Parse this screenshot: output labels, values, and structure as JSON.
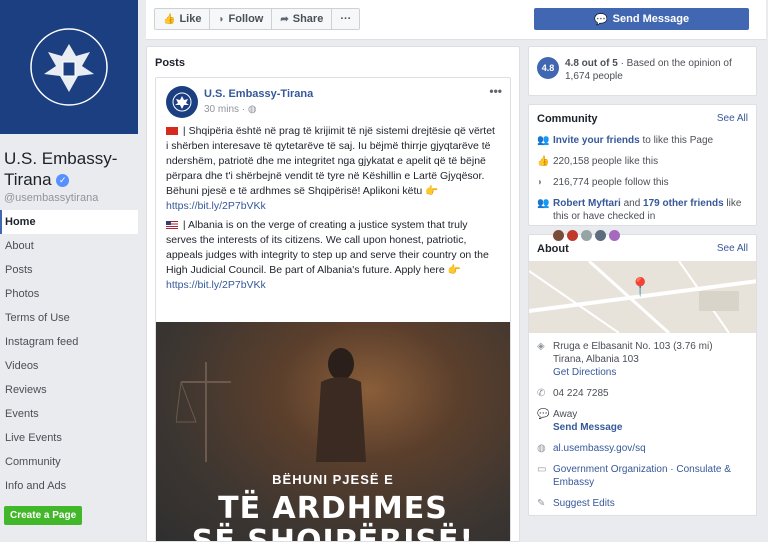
{
  "page": {
    "name": "U.S. Embassy-Tirana",
    "handle": "@usembassytirana"
  },
  "nav": [
    {
      "label": "Home"
    },
    {
      "label": "About"
    },
    {
      "label": "Posts"
    },
    {
      "label": "Photos"
    },
    {
      "label": "Terms of Use"
    },
    {
      "label": "Instagram feed"
    },
    {
      "label": "Videos"
    },
    {
      "label": "Reviews"
    },
    {
      "label": "Events"
    },
    {
      "label": "Live Events"
    },
    {
      "label": "Community"
    },
    {
      "label": "Info and Ads"
    }
  ],
  "create_page": "Create a Page",
  "actions": {
    "like": "Like",
    "follow": "Follow",
    "share": "Share",
    "more": "···",
    "send_message": "Send Message"
  },
  "posts": {
    "header": "Posts",
    "post": {
      "author": "U.S. Embassy-Tirana",
      "time": "30 mins",
      "text_sq": "| Shqipëria është në prag të krijimit të një sistemi drejtësie që vërtet i shërben interesave të qytetarëve të saj. Iu bëjmë thirrje gjyqtarëve të ndershëm, patriotë dhe me integritet nga gjykatat e apelit që të bëjnë përpara dhe t'i shërbejnë vendit të tyre në Këshillin e Lartë Gjyqësor. Bëhuni pjesë e të ardhmes së Shqipërisë! Aplikoni këtu",
      "link_sq": "https://bit.ly/2P7bVKk",
      "text_en": "| Albania is on the verge of creating a justice system that truly serves the interests of its citizens. We call upon honest, patriotic, appeals judges with integrity to step up and serve their country on the High Judicial Council. Be part of Albania's future. Apply here",
      "link_en": "https://bit.ly/2P7bVKk",
      "image_sub": "BËHUNI PJESË E",
      "image_title_1": "TË ARDHMES",
      "image_title_2": "SË SHQIPËRISË!"
    }
  },
  "rating": {
    "score": "4.8",
    "text_bold": "4.8 out of 5",
    "text": " · Based on the opinion of 1,674 people"
  },
  "community": {
    "title": "Community",
    "see_all": "See All",
    "invite": "Invite your friends",
    "invite_rest": " to like this Page",
    "likes": "220,158 people like this",
    "follows": "216,774 people follow this",
    "friend": "Robert Myftari",
    "friend_and": " and ",
    "friends_other": "179 other friends",
    "friends_rest": " like this or have checked in",
    "friend_colors": [
      "#7b4b3a",
      "#c0392b",
      "#95a5a6",
      "#5d6d7e",
      "#a569bd"
    ]
  },
  "about": {
    "title": "About",
    "see_all": "See All",
    "address_1": "Rruga e Elbasanit No. 103 (3.76 mi)",
    "address_2": "Tirana, Albania 103",
    "directions": "Get Directions",
    "phone": "04 224 7285",
    "away": "Away",
    "send_message": "Send Message",
    "website": "al.usembassy.gov/sq",
    "category": "Government Organization · Consulate & Embassy",
    "suggest": "Suggest Edits"
  },
  "icons": {
    "like": "thumbs-up-icon",
    "follow": "rss-icon",
    "share": "share-arrow-icon",
    "messenger": "messenger-icon",
    "globe": "globe-icon",
    "pin": "map-pin-icon"
  },
  "colors": {
    "brand": "#4267b2",
    "link": "#365899",
    "create": "#42b72a",
    "cover": "#1c3f82"
  }
}
